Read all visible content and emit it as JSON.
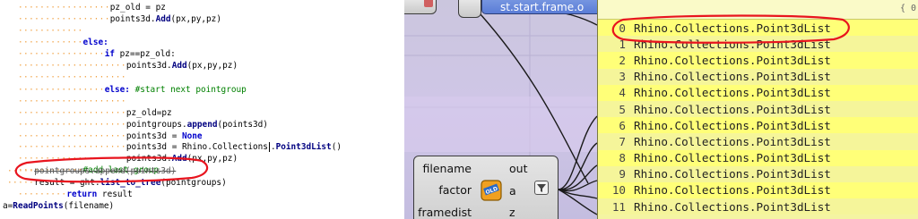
{
  "code": {
    "lines": [
      {
        "indent": "·················",
        "parts": [
          {
            "cls": "txt",
            "text": "pz_old = pz"
          }
        ]
      },
      {
        "indent": "·················",
        "parts": [
          {
            "cls": "txt",
            "text": "points3d."
          },
          {
            "cls": "fn",
            "text": "Add"
          },
          {
            "cls": "txt",
            "text": "(px,py,pz)"
          }
        ]
      },
      {
        "indent": "············",
        "parts": []
      },
      {
        "indent": "············",
        "parts": [
          {
            "cls": "kw",
            "text": "else:"
          }
        ]
      },
      {
        "indent": "················",
        "parts": [
          {
            "cls": "kw",
            "text": "if "
          },
          {
            "cls": "txt",
            "text": "pz==pz_old:"
          }
        ]
      },
      {
        "indent": "····················",
        "parts": [
          {
            "cls": "txt",
            "text": "points3d."
          },
          {
            "cls": "fn",
            "text": "Add"
          },
          {
            "cls": "txt",
            "text": "(px,py,pz)"
          }
        ]
      },
      {
        "indent": "····················",
        "parts": []
      },
      {
        "indent": "················",
        "parts": [
          {
            "cls": "kw",
            "text": "else: "
          },
          {
            "cls": "cm",
            "text": "#start next pointgroup"
          }
        ]
      },
      {
        "indent": "····················",
        "parts": []
      },
      {
        "indent": "····················",
        "parts": [
          {
            "cls": "txt",
            "text": "pz_old=pz"
          }
        ]
      },
      {
        "indent": "····················",
        "parts": [
          {
            "cls": "txt",
            "text": "pointgroups."
          },
          {
            "cls": "fn",
            "text": "append"
          },
          {
            "cls": "txt",
            "text": "(points3d)"
          }
        ]
      },
      {
        "indent": "····················",
        "parts": [
          {
            "cls": "txt",
            "text": "points3d = "
          },
          {
            "cls": "kw",
            "text": "None"
          }
        ]
      },
      {
        "indent": "····················",
        "parts": [
          {
            "cls": "txt",
            "text": "points3d = Rhino.Collections"
          },
          {
            "cls": "caret",
            "text": ""
          },
          {
            "cls": "txt",
            "text": "."
          },
          {
            "cls": "fn",
            "text": "Point3dList"
          },
          {
            "cls": "txt",
            "text": "()"
          }
        ]
      },
      {
        "indent": "····················",
        "parts": [
          {
            "cls": "txt",
            "text": "points3d."
          },
          {
            "cls": "fn",
            "text": "Add"
          },
          {
            "cls": "txt",
            "text": "(px,py,pz)"
          }
        ]
      },
      {
        "indent": "············",
        "parts": [
          {
            "cls": "cm",
            "text": "#add last group"
          }
        ]
      },
      {
        "indent": "·····",
        "parts": [
          {
            "cls": "txt",
            "text": "pointgroups.append(points3d)"
          }
        ]
      },
      {
        "indent": "·····",
        "parts": [
          {
            "cls": "txt",
            "text": "result = ght."
          },
          {
            "cls": "fn",
            "text": "list_to_tree"
          },
          {
            "cls": "txt",
            "text": "(pointgroups)"
          }
        ]
      },
      {
        "indent": "·········",
        "parts": [
          {
            "cls": "kw",
            "text": "return "
          },
          {
            "cls": "txt",
            "text": "result"
          }
        ]
      },
      {
        "indent": "",
        "parts": [
          {
            "cls": "txt",
            "text": "a="
          },
          {
            "cls": "fn",
            "text": "ReadPoints"
          },
          {
            "cls": "txt",
            "text": "(filename)"
          }
        ]
      }
    ]
  },
  "canvas": {
    "frame_component_label": "st.start.frame.o",
    "readpoints": {
      "inputs": [
        "filename",
        "factor",
        "framedist"
      ],
      "outputs": [
        "out",
        "a",
        "z"
      ]
    }
  },
  "panel": {
    "path_label": "{ 0",
    "rows": [
      {
        "index": "0",
        "value": "Rhino.Collections.Point3dList"
      },
      {
        "index": "1",
        "value": "Rhino.Collections.Point3dList"
      },
      {
        "index": "2",
        "value": "Rhino.Collections.Point3dList"
      },
      {
        "index": "3",
        "value": "Rhino.Collections.Point3dList"
      },
      {
        "index": "4",
        "value": "Rhino.Collections.Point3dList"
      },
      {
        "index": "5",
        "value": "Rhino.Collections.Point3dList"
      },
      {
        "index": "6",
        "value": "Rhino.Collections.Point3dList"
      },
      {
        "index": "7",
        "value": "Rhino.Collections.Point3dList"
      },
      {
        "index": "8",
        "value": "Rhino.Collections.Point3dList"
      },
      {
        "index": "9",
        "value": "Rhino.Collections.Point3dList"
      },
      {
        "index": "10",
        "value": "Rhino.Collections.Point3dList"
      },
      {
        "index": "11",
        "value": "Rhino.Collections.Point3dList"
      }
    ]
  },
  "colors": {
    "panel_bg": "#ffff78",
    "annotation_red": "#e8141e",
    "keyword_blue": "#0000cc",
    "comment_green": "#008000",
    "indent_dots": "#f0a040"
  }
}
